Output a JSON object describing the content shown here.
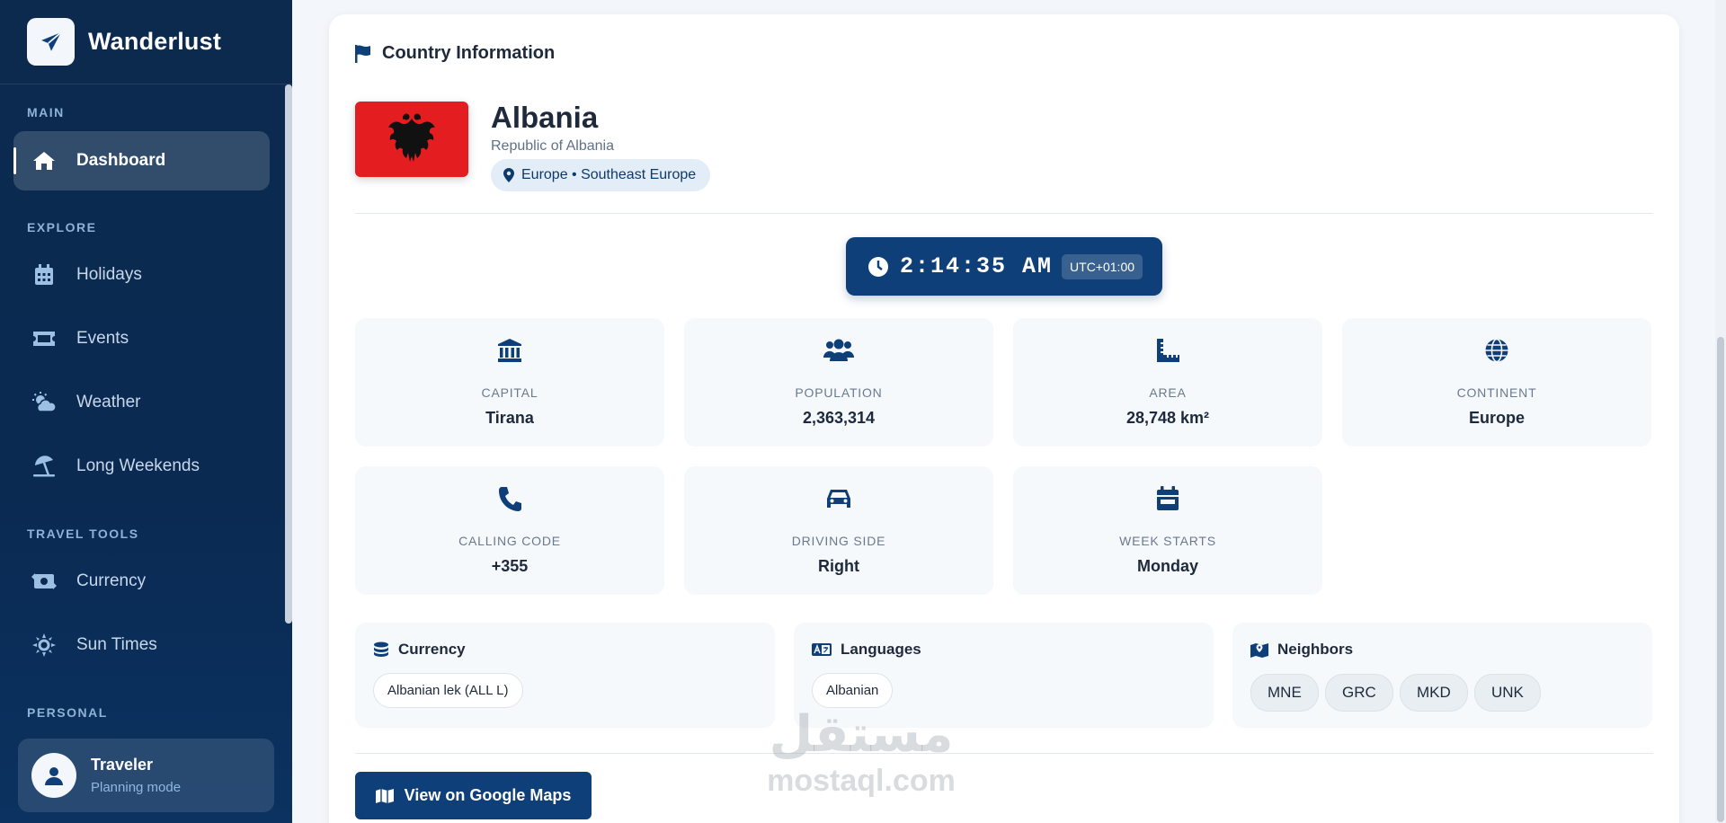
{
  "brand": {
    "name": "Wanderlust"
  },
  "sidebar": {
    "sections": {
      "main": "MAIN",
      "explore": "EXPLORE",
      "travel_tools": "TRAVEL TOOLS",
      "personal": "PERSONAL"
    },
    "items": [
      {
        "label": "Dashboard",
        "icon": "home-icon",
        "active": true
      },
      {
        "label": "Holidays",
        "icon": "calendar-grid-icon"
      },
      {
        "label": "Events",
        "icon": "ticket-icon"
      },
      {
        "label": "Weather",
        "icon": "sun-cloud-icon"
      },
      {
        "label": "Long Weekends",
        "icon": "umbrella-beach-icon"
      },
      {
        "label": "Currency",
        "icon": "money-exchange-icon"
      },
      {
        "label": "Sun Times",
        "icon": "sun-icon"
      }
    ],
    "user": {
      "name": "Traveler",
      "status": "Planning mode"
    }
  },
  "country_card": {
    "header": "Country Information",
    "name": "Albania",
    "official_name": "Republic of Albania",
    "region": "Europe • Southeast Europe",
    "clock": {
      "time": "2:14:35 AM",
      "timezone": "UTC+01:00"
    },
    "stats": [
      {
        "label": "CAPITAL",
        "value": "Tirana",
        "icon": "landmark-icon"
      },
      {
        "label": "POPULATION",
        "value": "2,363,314",
        "icon": "users-icon"
      },
      {
        "label": "AREA",
        "value": "28,748 km²",
        "icon": "ruler-icon"
      },
      {
        "label": "CONTINENT",
        "value": "Europe",
        "icon": "globe-icon"
      },
      {
        "label": "CALLING CODE",
        "value": "+355",
        "icon": "phone-icon"
      },
      {
        "label": "DRIVING SIDE",
        "value": "Right",
        "icon": "car-icon"
      },
      {
        "label": "WEEK STARTS",
        "value": "Monday",
        "icon": "calendar-icon"
      }
    ],
    "currency": {
      "title": "Currency",
      "items": [
        "Albanian lek (ALL L)"
      ]
    },
    "languages": {
      "title": "Languages",
      "items": [
        "Albanian"
      ]
    },
    "neighbors": {
      "title": "Neighbors",
      "items": [
        "MNE",
        "GRC",
        "MKD",
        "UNK"
      ]
    },
    "maps_button": "View on Google Maps"
  },
  "watermark": {
    "arabic": "مستقل",
    "latin": "mostaql.com"
  },
  "colors": {
    "sidebar": "#0c2a4e",
    "accent": "#0e3f78",
    "flag_red": "#e41e20"
  }
}
